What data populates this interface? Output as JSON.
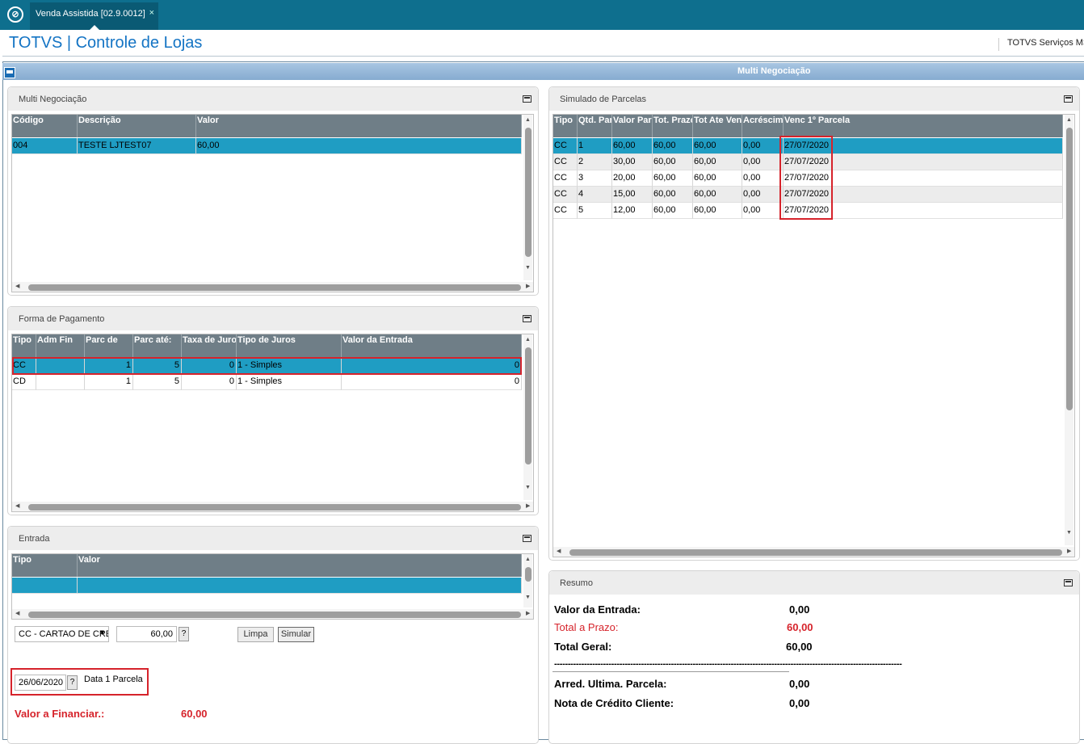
{
  "topbar": {
    "logo": "totvs-logo",
    "tab_label": "Venda Assistida [02.9.0012]",
    "tab_close": "×"
  },
  "header": {
    "title": "TOTVS | Controle de Lojas",
    "company": "TOTVS Serviços MS"
  },
  "window": {
    "title": "Multi Negociação"
  },
  "multi": {
    "title": "Multi Negociação",
    "columns": [
      "Código",
      "Descrição",
      "Valor"
    ],
    "rows": [
      [
        "004",
        "TESTE LJTEST07",
        "60,00"
      ]
    ]
  },
  "forma": {
    "title": "Forma de Pagamento",
    "columns": [
      "Tipo",
      "Adm Fin",
      "Parc de",
      "Parc até:",
      "Taxa de Juro",
      "Tipo de Juros",
      "Valor da Entrada"
    ],
    "rows": [
      [
        "CC",
        "",
        "1",
        "5",
        "0",
        "1 - Simples",
        "0"
      ],
      [
        "CD",
        "",
        "1",
        "5",
        "0",
        "1 - Simples",
        "0"
      ]
    ]
  },
  "entrada": {
    "title": "Entrada",
    "columns": [
      "Tipo",
      "Valor"
    ],
    "payment_select": "CC - CARTAO DE CREDITO",
    "value": "60,00",
    "help": "?",
    "limpa": "Limpa",
    "simular": "Simular",
    "date_value": "26/06/2020",
    "date_label": "Data 1 Parcela",
    "financiar_label": "Valor a Financiar.:",
    "financiar_value": "60,00"
  },
  "simulado": {
    "title": "Simulado de Parcelas",
    "columns": [
      "Tipo",
      "Qtd. Parc",
      "Valor Parc",
      "Tot. Prazo",
      "Tot Ate Venc",
      "Acréscimo",
      "Venc 1º Parcela"
    ],
    "rows": [
      [
        "CC",
        "1",
        "60,00",
        "60,00",
        "60,00",
        "0,00",
        "27/07/2020"
      ],
      [
        "CC",
        "2",
        "30,00",
        "60,00",
        "60,00",
        "0,00",
        "27/07/2020"
      ],
      [
        "CC",
        "3",
        "20,00",
        "60,00",
        "60,00",
        "0,00",
        "27/07/2020"
      ],
      [
        "CC",
        "4",
        "15,00",
        "60,00",
        "60,00",
        "0,00",
        "27/07/2020"
      ],
      [
        "CC",
        "5",
        "12,00",
        "60,00",
        "60,00",
        "0,00",
        "27/07/2020"
      ]
    ]
  },
  "resumo": {
    "title": "Resumo",
    "entrada_label": "Valor da Entrada:",
    "entrada_value": "0,00",
    "prazo_label": "Total a Prazo:",
    "prazo_value": "60,00",
    "geral_label": "Total Geral:",
    "geral_value": "60,00",
    "separator": "--------------------------------------------------------------------------------------------------------------------------------",
    "arred_label": "Arred. Ultima. Parcela:",
    "arred_value": "0,00",
    "nota_label": "Nota de Crédito Cliente:",
    "nota_value": "0,00"
  },
  "colors": {
    "accent": "#0e6f8e",
    "selected_row": "#1f9dc3",
    "red": "#d6232b",
    "grid_header": "#6f7e87"
  }
}
